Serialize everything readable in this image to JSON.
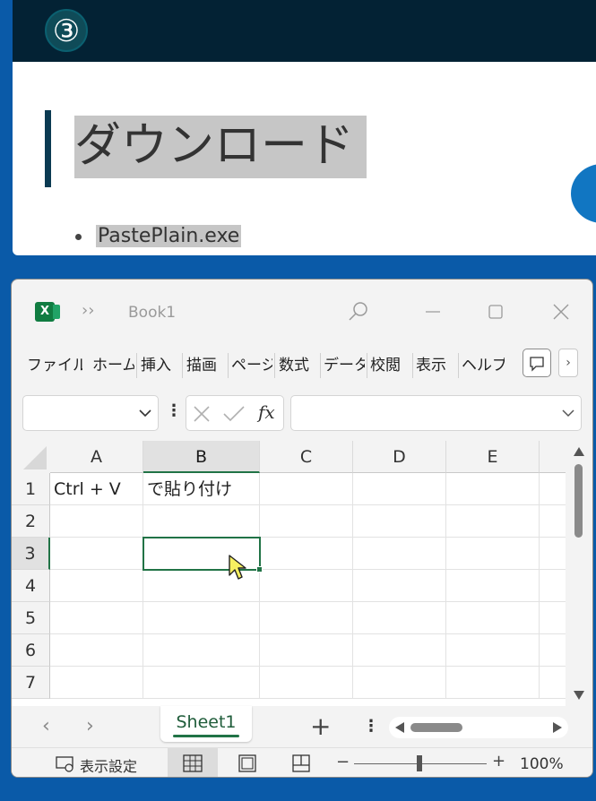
{
  "web": {
    "step_number": "③",
    "heading": "ダウンロード",
    "bullet_item": "PastePlain.exe"
  },
  "excel": {
    "doc_title": "Book1",
    "more_glyph": "››",
    "ribbon_tabs": [
      "ファイル",
      "ホーム",
      "挿入",
      "描画",
      "ページ",
      "数式",
      "データ",
      "校閲",
      "表示",
      "ヘルプ"
    ],
    "fx_label": "fx",
    "columns": [
      "A",
      "B",
      "C",
      "D",
      "E"
    ],
    "rows": [
      "1",
      "2",
      "3",
      "4",
      "5",
      "6",
      "7"
    ],
    "cells": {
      "A1": "Ctrl + V",
      "B1": "で貼り付け"
    },
    "active_cell": "B3",
    "sheet_tab": "Sheet1",
    "status": {
      "display_settings": "表示設定",
      "zoom": "100%",
      "zoom_minus": "−",
      "zoom_plus": "+"
    },
    "nav_prev": "‹",
    "nav_next": "›",
    "add_sheet": "+"
  }
}
